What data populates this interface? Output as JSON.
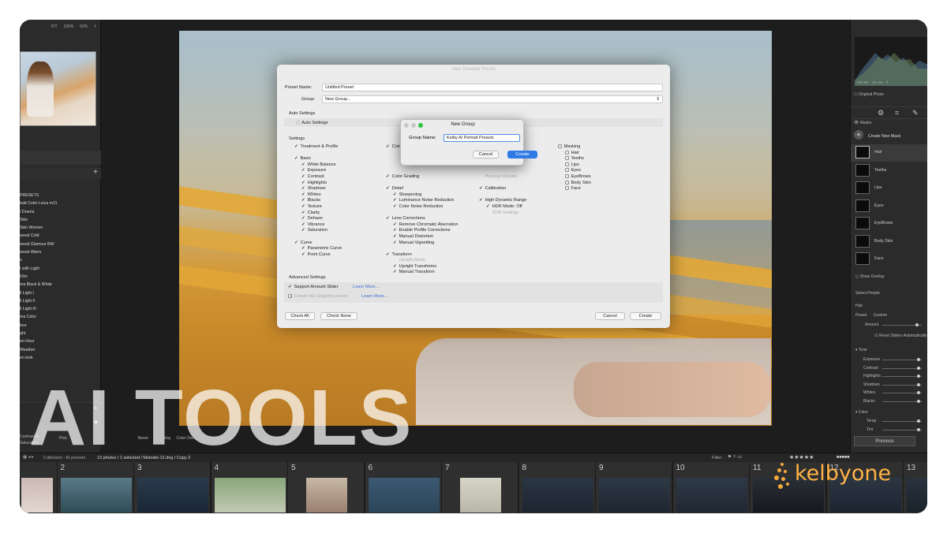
{
  "left_panel": {
    "zoom": [
      "FIT",
      "100%",
      "50%",
      "†"
    ],
    "presets": [
      "PRESETS",
      "trait Color Leica m11",
      "/ Drama",
      "Skin",
      "Skin Women",
      "wood Cold",
      "wood Glamour BW",
      "wood Warm",
      "e",
      "t with Light",
      "",
      "Film",
      "ma Black & White",
      "ll Light I",
      "ll Light II",
      "ll Light III",
      "ma Color",
      "lour",
      "ght",
      "en Hour",
      "",
      "Weather",
      "en look"
    ],
    "bottom_items": [
      "Contrast Ai",
      "Saturation"
    ]
  },
  "dialog": {
    "title": "New Develop Preset",
    "preset_name_label": "Preset Name:",
    "preset_name_value": "Untitled Preset",
    "group_label": "Group:",
    "group_value": "New Group...",
    "auto_settings_header": "Auto Settings",
    "auto_settings_item": "Auto Settings",
    "settings_header": "Settings",
    "col1": [
      "Treatment & Profile",
      "",
      "Basic",
      "White Balance",
      "Exposure",
      "Contrast",
      "Highlights",
      "Shadows",
      "Whites",
      "Blacks",
      "Texture",
      "Clarity",
      "Dehaze",
      "Vibrance",
      "Saturation",
      "",
      "Curve",
      "Parametric Curve",
      "Point Curve"
    ],
    "col2": [
      "Colo",
      "",
      "",
      "",
      "",
      "Color Grading",
      "",
      "Detail",
      "Sharpening",
      "Luminance Noise Reduction",
      "Color Noise Reduction",
      "",
      "Lens Corrections",
      "Remove Chromatic Aberration",
      "Enable Profile Corrections",
      "Manual Distortion",
      "Manual Vignetting",
      "",
      "Transform",
      "Upright Mode",
      "Upright Transforms",
      "Manual Transform"
    ],
    "col3": [
      "",
      "",
      "",
      "",
      "",
      "Process Version",
      "",
      "Calibration",
      "",
      "High Dynamic Range",
      "HDR Mode: Off",
      "SDR Settings"
    ],
    "col4": [
      "Masking",
      "Hair",
      "Teeths",
      "Lips",
      "Eyes",
      "EyeBrows",
      "Body Skin",
      "Face"
    ],
    "advanced_header": "Advanced Settings",
    "support_amount": "Support Amount Slider",
    "learn_more": "Learn More...",
    "create_iso": "Create ISO adaptive preset",
    "learn_more2": "Learn More...",
    "check_all": "Check All",
    "check_none": "Check None",
    "cancel": "Cancel",
    "create": "Create"
  },
  "new_group": {
    "title": "New Group",
    "label": "Group Name:",
    "value": "Kelby AI Portrait Presets",
    "cancel": "Cancel",
    "create": "Create"
  },
  "right_panel": {
    "histo_info": [
      "ISO 50",
      "35 mm",
      "f/"
    ],
    "original_photo": "Original Photo",
    "masks_header": "Masks",
    "create_mask": "Create New Mask",
    "masks": [
      "Hair",
      "Teeths",
      "Lips",
      "Eyes",
      "EyeBrows",
      "Body Skin",
      "Face"
    ],
    "show_overlay": "Show Overlay",
    "select_people": "Select People",
    "hair": "Hair",
    "preset": "Preset",
    "custom": "Custom",
    "amount": "Amount",
    "reset_sliders": "Reset Sliders Automatically",
    "tone": "Tone",
    "tone_items": [
      "Exposure",
      "Contrast",
      "Highlights",
      "Shadows",
      "Whites",
      "Blacks"
    ],
    "color": "Color",
    "color_items": [
      "Temp",
      "Tint"
    ],
    "previous": "Previous"
  },
  "bottom_bar": {
    "items": [
      "Pick:",
      "Never",
      "Overlay",
      "Color Overlay"
    ],
    "collection": "Collection : AI presets",
    "count": "13 photos / 1 selected / Melodie-12.dng / Copy 2",
    "filter": "Filter:"
  },
  "headline": "AI TOOLS",
  "logo": "kelbyone",
  "filmstrip": [
    "",
    "2",
    "3",
    "4",
    "5",
    "6",
    "7",
    "8",
    "9",
    "10",
    "11",
    "12",
    "13"
  ]
}
